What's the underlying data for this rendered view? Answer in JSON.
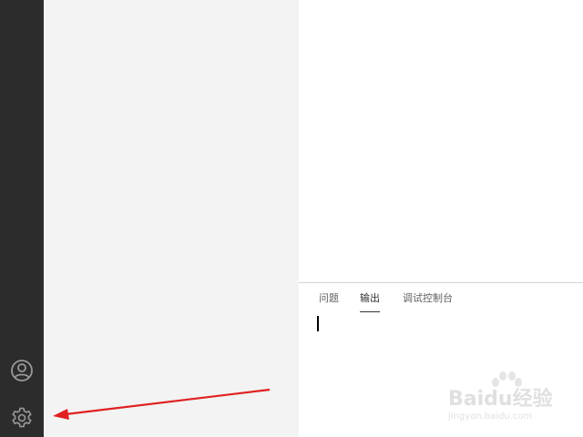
{
  "activity_bar": {
    "icons": {
      "account": "account-icon",
      "settings": "gear-icon"
    }
  },
  "panel": {
    "tabs": [
      {
        "label": "问题",
        "active": false
      },
      {
        "label": "输出",
        "active": true
      },
      {
        "label": "调试控制台",
        "active": false
      }
    ]
  },
  "annotation": {
    "color": "#e02020"
  },
  "watermark": {
    "brand": "Baidu经验",
    "url": "jingyan.baidu.com"
  }
}
